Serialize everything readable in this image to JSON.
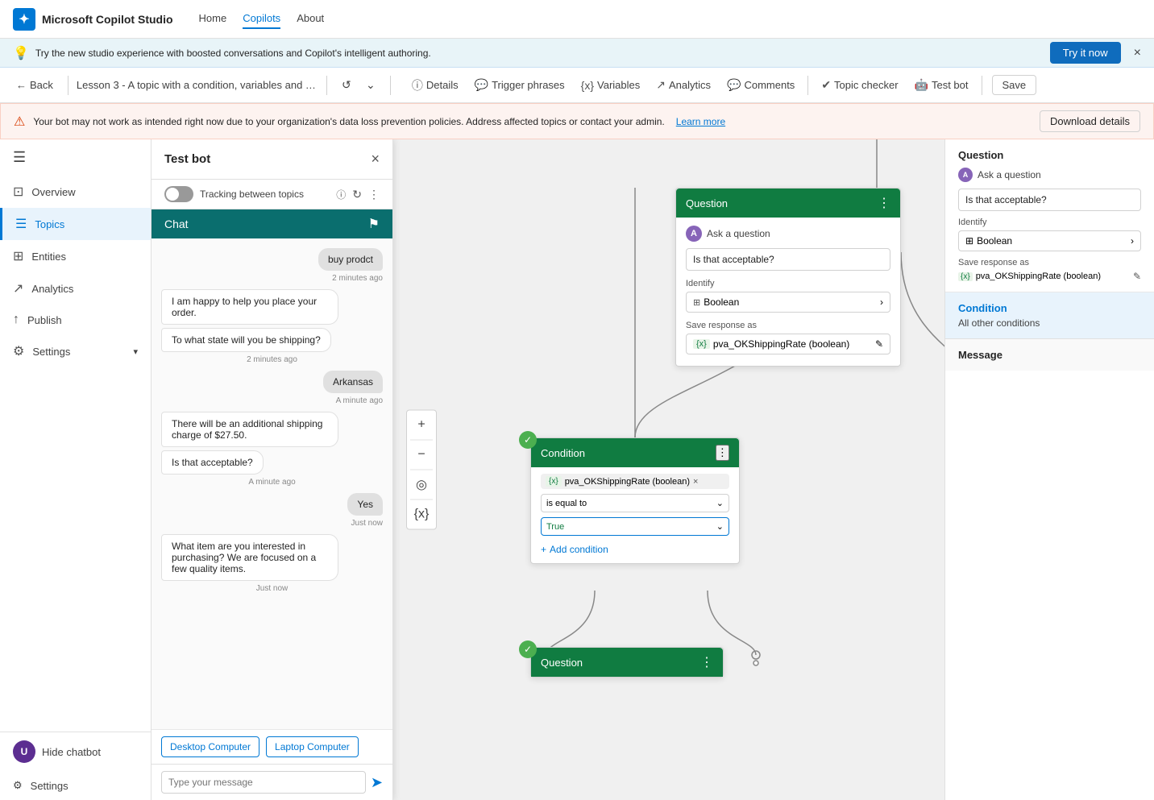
{
  "app": {
    "title": "Microsoft Copilot Studio",
    "logo_char": "✦",
    "nav": {
      "links": [
        "Home",
        "Copilots",
        "About"
      ],
      "active": "Copilots"
    }
  },
  "banner": {
    "text": "Try the new studio experience with boosted conversations and Copilot's intelligent authoring.",
    "cta": "Try it now",
    "close": "×"
  },
  "toolbar": {
    "back": "Back",
    "breadcrumb": "Lesson 3 - A topic with a condition, variables and a pr...",
    "actions": [
      "Details",
      "Trigger phrases",
      "Variables",
      "Analytics",
      "Comments",
      "Topic checker",
      "Test bot",
      "Save"
    ],
    "details_label": "Details",
    "trigger_label": "Trigger phrases",
    "variables_label": "Variables",
    "analytics_label": "Analytics",
    "comments_label": "Comments",
    "topic_checker_label": "Topic checker",
    "test_bot_label": "Test bot",
    "save_label": "Save"
  },
  "warning": {
    "text": "Your bot may not work as intended right now due to your organization's data loss prevention policies. Address affected topics or contact your admin.",
    "link": "Learn more",
    "download_btn": "Download details"
  },
  "sidebar": {
    "items": [
      {
        "label": "Overview",
        "icon": "⊡"
      },
      {
        "label": "Topics",
        "icon": "☰"
      },
      {
        "label": "Entities",
        "icon": "⊞"
      },
      {
        "label": "Analytics",
        "icon": "↗"
      },
      {
        "label": "Publish",
        "icon": "↑"
      }
    ],
    "settings_expand": "Settings",
    "hide_chatbot": "Hide chatbot",
    "settings_bottom": "Settings",
    "avatar_initials": "U"
  },
  "testbot": {
    "title": "Test bot",
    "tracking_label": "Tracking between topics",
    "chat_title": "Chat",
    "messages": [
      {
        "type": "right",
        "text": "buy prodct",
        "time": "2 minutes ago"
      },
      {
        "type": "left",
        "text": "I am happy to help you place your order.",
        "time": null
      },
      {
        "type": "left",
        "text": "To what state will you be shipping?",
        "time": "2 minutes ago"
      },
      {
        "type": "right",
        "text": "Arkansas",
        "time": "A minute ago"
      },
      {
        "type": "left",
        "text": "There will be an additional shipping charge of $27.50.",
        "time": null
      },
      {
        "type": "left",
        "text": "Is that acceptable?",
        "time": "A minute ago"
      },
      {
        "type": "right",
        "text": "Yes",
        "time": "Just now"
      },
      {
        "type": "left",
        "text": "What item are you interested in purchasing? We are focused on a few quality items.",
        "time": "Just now"
      }
    ],
    "options": [
      "Desktop Computer",
      "Laptop Computer"
    ],
    "input_placeholder": "Type your message"
  },
  "canvas": {
    "zoom_in": "+",
    "zoom_out": "−",
    "locate": "◎",
    "fit": "⊡",
    "variable_x": "{x}"
  },
  "question_node": {
    "title": "Question",
    "ask_label": "Ask a question",
    "question_text": "Is that acceptable?",
    "identify_label": "Identify",
    "identify_value": "Boolean",
    "save_response_label": "Save response as",
    "var_name": "pva_OKShippingRate (boolean)",
    "var_prefix": "{x}"
  },
  "condition_node": {
    "title": "Condition",
    "var_tag": "pva_OKShippingRate (boolean)",
    "var_prefix": "{x}",
    "operator": "is equal to",
    "value": "True"
  },
  "right_panel": {
    "question_title": "Question",
    "ask_label": "Ask a question",
    "question_text": "Is that acceptable?",
    "identify_label": "Identify",
    "identify_value": "Boolean",
    "save_response_label": "Save response as",
    "var_name": "pva_OKShippingRate (boolean)",
    "condition_title": "Condition",
    "condition_sub": "All other conditions",
    "message_title": "Message"
  },
  "colors": {
    "brand_green": "#107c41",
    "brand_blue": "#0078d4",
    "brand_dark": "#0a6e6e",
    "accent_purple": "#8764b8",
    "success_green": "#4caf50"
  }
}
